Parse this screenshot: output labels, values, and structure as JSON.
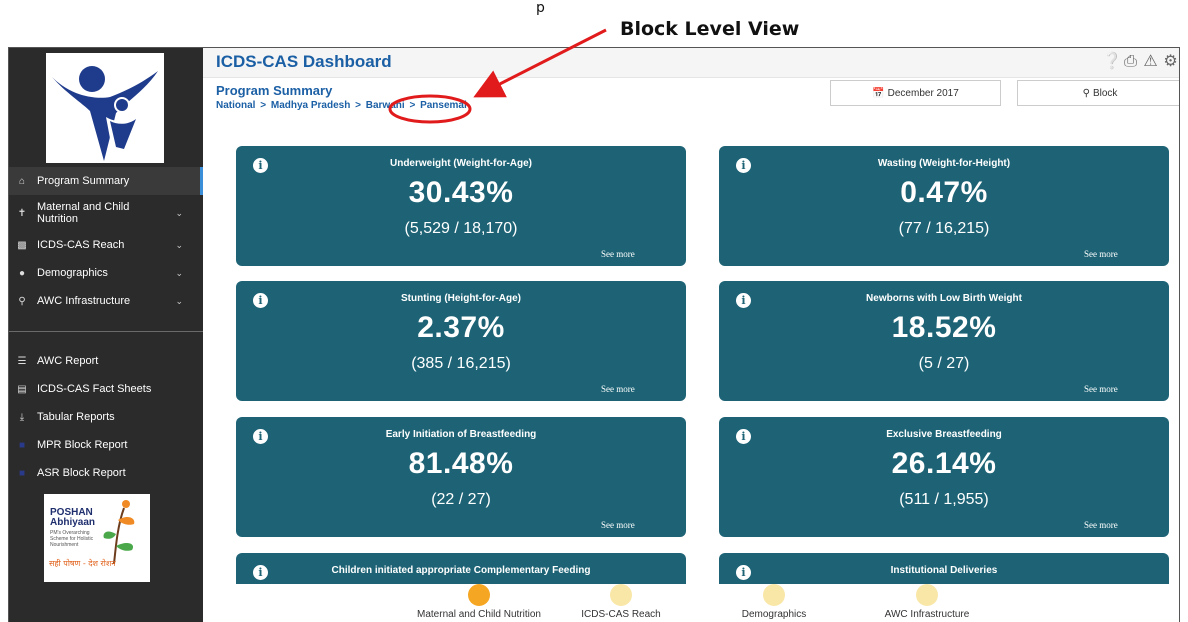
{
  "annotation": {
    "label": "Block Level View",
    "fragment": "p",
    "arrow_color": "#e11b1b"
  },
  "sidebar": {
    "items": [
      {
        "label": "Program Summary",
        "icon": "home-icon",
        "active": true
      },
      {
        "label": "Maternal and Child Nutrition",
        "icon": "person-icon",
        "chevron": true
      },
      {
        "label": "ICDS-CAS Reach",
        "icon": "bar-chart-icon",
        "chevron": true
      },
      {
        "label": "Demographics",
        "icon": "users-icon",
        "chevron": true
      },
      {
        "label": "AWC Infrastructure",
        "icon": "map-marker-icon",
        "chevron": true
      }
    ],
    "reports": [
      {
        "label": "AWC Report",
        "icon": "list-icon"
      },
      {
        "label": "ICDS-CAS Fact Sheets",
        "icon": "document-icon"
      },
      {
        "label": "Tabular Reports",
        "icon": "download-icon"
      },
      {
        "label": "MPR Block Report",
        "icon": "report-icon"
      },
      {
        "label": "ASR Block Report",
        "icon": "report-icon"
      }
    ],
    "poshan": {
      "title_line1": "POSHAN",
      "title_line2": "Abhiyaan",
      "sub1": "PM's Overarching",
      "sub2": "Scheme for Holistic",
      "sub3": "Nourishment",
      "tagline": "सही पोषण - देश रोशन"
    }
  },
  "header": {
    "title": "ICDS-CAS Dashboard",
    "icons": [
      "help-icon",
      "print-icon",
      "warning-icon",
      "gear-icon"
    ]
  },
  "page": {
    "title": "Program Summary",
    "breadcrumb": [
      "National",
      "Madhya Pradesh",
      "Barwani",
      "Pansemal"
    ],
    "sep": ">"
  },
  "filters": {
    "date": "December 2017",
    "location": "Block"
  },
  "cards": [
    {
      "title": "Underweight (Weight-for-Age)",
      "value": "30.43%",
      "fraction": "(5,529 / 18,170)",
      "more": "See more"
    },
    {
      "title": "Wasting (Weight-for-Height)",
      "value": "0.47%",
      "fraction": "(77 / 16,215)",
      "more": "See more"
    },
    {
      "title": "Stunting (Height-for-Age)",
      "value": "2.37%",
      "fraction": "(385 / 16,215)",
      "more": "See more"
    },
    {
      "title": "Newborns with Low Birth Weight",
      "value": "18.52%",
      "fraction": "(5 / 27)",
      "more": "See more"
    },
    {
      "title": "Early Initiation of Breastfeeding",
      "value": "81.48%",
      "fraction": "(22 / 27)",
      "more": "See more"
    },
    {
      "title": "Exclusive Breastfeeding",
      "value": "26.14%",
      "fraction": "(511 / 1,955)",
      "more": "See more"
    },
    {
      "title": "Children initiated appropriate Complementary Feeding"
    },
    {
      "title": "Institutional Deliveries"
    }
  ],
  "section_nav": [
    {
      "label": "Maternal and Child Nutrition",
      "active": true
    },
    {
      "label": "ICDS-CAS Reach",
      "active": false
    },
    {
      "label": "Demographics",
      "active": false
    },
    {
      "label": "AWC Infrastructure",
      "active": false
    }
  ],
  "colors": {
    "card": "#1d6375",
    "brand": "#1b5fa5",
    "sidebar": "#2b2b2b",
    "dot_active": "#f5a623",
    "dot_inactive": "#f9e7a8"
  }
}
